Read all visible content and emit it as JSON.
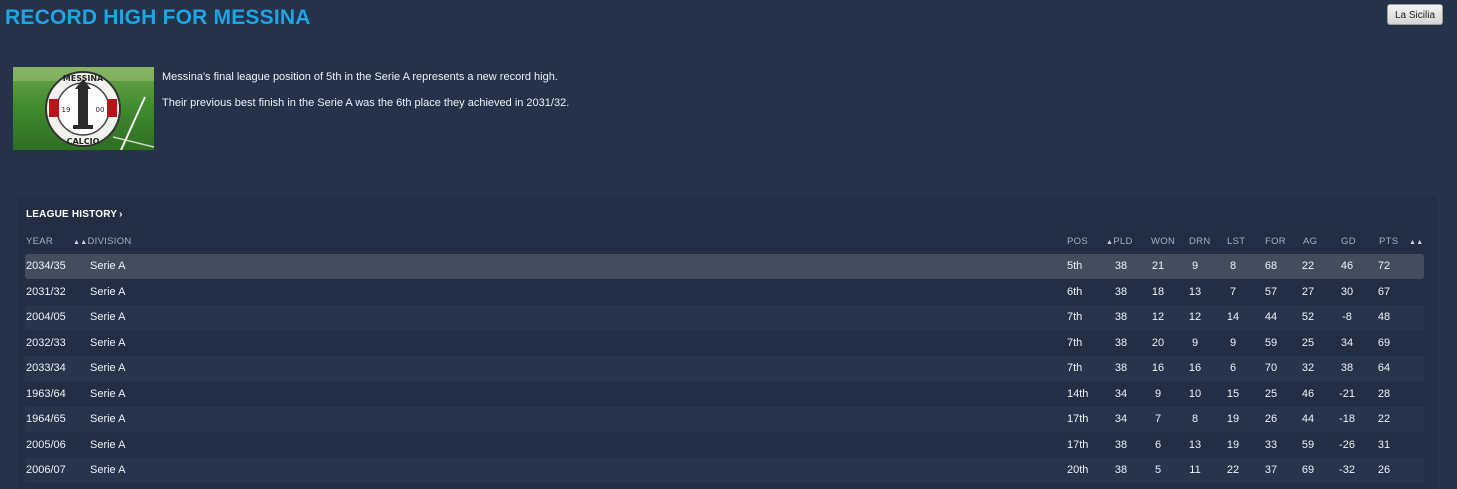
{
  "page": {
    "title": "RECORD HIGH FOR MESSINA",
    "source_button": "La Sicilia"
  },
  "logo": {
    "top_text": "MESSINA",
    "bottom_text": "CALCIO",
    "year_left": "19",
    "year_right": "00"
  },
  "news": {
    "line1": "Messina's final league position of 5th in the Serie A represents a new record high.",
    "line2": "Their previous best finish in the Serie A was the 6th place they achieved in 2031/32."
  },
  "league_history": {
    "section_label": "LEAGUE HISTORY",
    "columns": {
      "year": "YEAR",
      "division": "DIVISION",
      "pos": "POS",
      "pld": "PLD",
      "won": "WON",
      "drn": "DRN",
      "lst": "LST",
      "for": "FOR",
      "ag": "AG",
      "gd": "GD",
      "pts": "PTS"
    },
    "rows": [
      {
        "year": "2034/35",
        "division": "Serie A",
        "pos": "5th",
        "pld": "38",
        "won": "21",
        "drn": "9",
        "lst": "8",
        "for": "68",
        "ag": "22",
        "gd": "46",
        "pts": "72"
      },
      {
        "year": "2031/32",
        "division": "Serie A",
        "pos": "6th",
        "pld": "38",
        "won": "18",
        "drn": "13",
        "lst": "7",
        "for": "57",
        "ag": "27",
        "gd": "30",
        "pts": "67"
      },
      {
        "year": "2004/05",
        "division": "Serie A",
        "pos": "7th",
        "pld": "38",
        "won": "12",
        "drn": "12",
        "lst": "14",
        "for": "44",
        "ag": "52",
        "gd": "-8",
        "pts": "48"
      },
      {
        "year": "2032/33",
        "division": "Serie A",
        "pos": "7th",
        "pld": "38",
        "won": "20",
        "drn": "9",
        "lst": "9",
        "for": "59",
        "ag": "25",
        "gd": "34",
        "pts": "69"
      },
      {
        "year": "2033/34",
        "division": "Serie A",
        "pos": "7th",
        "pld": "38",
        "won": "16",
        "drn": "16",
        "lst": "6",
        "for": "70",
        "ag": "32",
        "gd": "38",
        "pts": "64"
      },
      {
        "year": "1963/64",
        "division": "Serie A",
        "pos": "14th",
        "pld": "34",
        "won": "9",
        "drn": "10",
        "lst": "15",
        "for": "25",
        "ag": "46",
        "gd": "-21",
        "pts": "28"
      },
      {
        "year": "1964/65",
        "division": "Serie A",
        "pos": "17th",
        "pld": "34",
        "won": "7",
        "drn": "8",
        "lst": "19",
        "for": "26",
        "ag": "44",
        "gd": "-18",
        "pts": "22"
      },
      {
        "year": "2005/06",
        "division": "Serie A",
        "pos": "17th",
        "pld": "38",
        "won": "6",
        "drn": "13",
        "lst": "19",
        "for": "33",
        "ag": "59",
        "gd": "-26",
        "pts": "31"
      },
      {
        "year": "2006/07",
        "division": "Serie A",
        "pos": "20th",
        "pld": "38",
        "won": "5",
        "drn": "11",
        "lst": "22",
        "for": "37",
        "ag": "69",
        "gd": "-32",
        "pts": "26"
      }
    ]
  }
}
